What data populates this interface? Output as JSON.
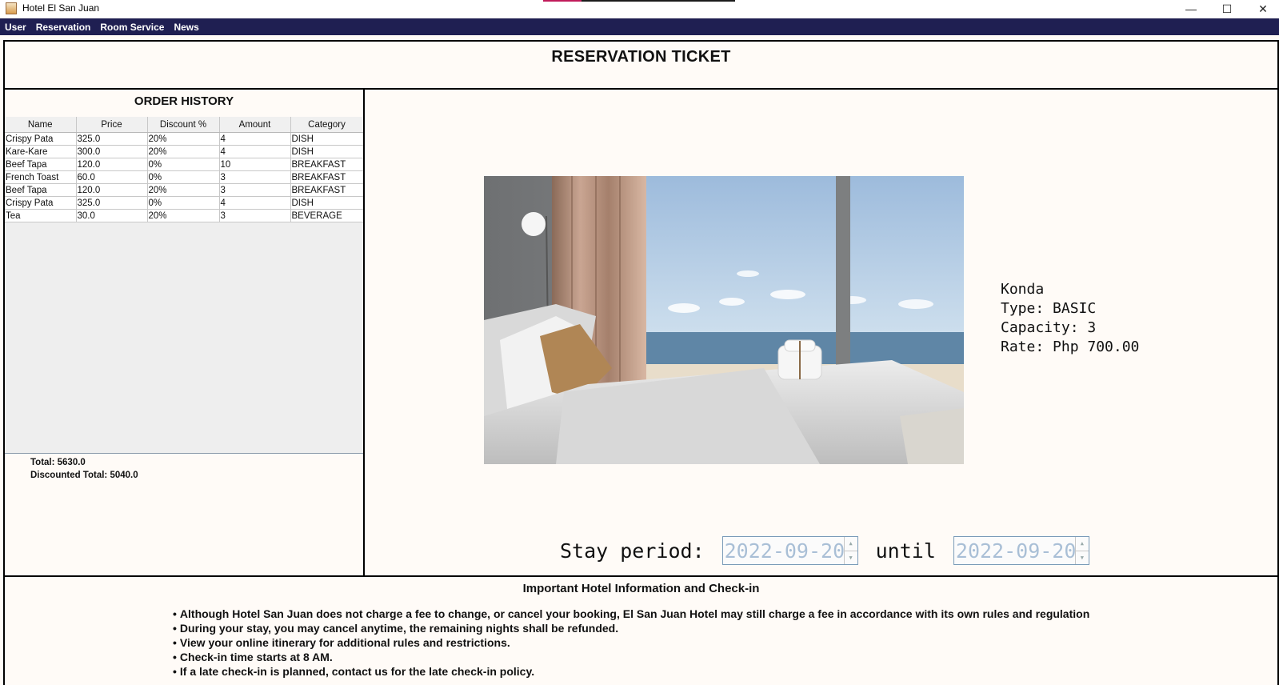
{
  "window": {
    "title": "Hotel El San Juan",
    "minimize_glyph": "—",
    "maximize_glyph": "☐",
    "close_glyph": "✕"
  },
  "menu": [
    "User",
    "Reservation",
    "Room Service",
    "News"
  ],
  "header": {
    "title": "RESERVATION TICKET"
  },
  "order_history": {
    "title": "ORDER HISTORY",
    "columns": [
      "Name",
      "Price",
      "Discount %",
      "Amount",
      "Category"
    ],
    "rows": [
      [
        "Crispy Pata",
        "325.0",
        "20%",
        "4",
        "DISH"
      ],
      [
        "Kare-Kare",
        "300.0",
        "20%",
        "4",
        "DISH"
      ],
      [
        "Beef Tapa",
        "120.0",
        "0%",
        "10",
        "BREAKFAST"
      ],
      [
        "French Toast",
        "60.0",
        "0%",
        "3",
        "BREAKFAST"
      ],
      [
        "Beef Tapa",
        "120.0",
        "20%",
        "3",
        "BREAKFAST"
      ],
      [
        "Crispy Pata",
        "325.0",
        "0%",
        "4",
        "DISH"
      ],
      [
        "Tea",
        "30.0",
        "20%",
        "3",
        "BEVERAGE"
      ]
    ],
    "total": "Total: 5630.0",
    "discounted_total": "Discounted Total: 5040.0"
  },
  "room": {
    "name": "Konda",
    "type": "Type: BASIC",
    "capacity": "Capacity: 3",
    "rate": "Rate: Php 700.00"
  },
  "stay": {
    "label": "Stay period:",
    "start": "2022-09-20",
    "until_label": "until",
    "end": "2022-09-20"
  },
  "info": {
    "title": "Important Hotel Information and Check-in",
    "items": [
      "Although Hotel San Juan does not charge a fee to change, or cancel your booking, El San Juan Hotel may still charge a fee in accordance with its own rules and regulation",
      "During your stay, you may cancel anytime, the remaining nights shall be refunded.",
      "View your online itinerary for additional rules and restrictions.",
      "Check-in time starts at 8 AM.",
      "If a late check-in is planned, contact us for the late check-in policy."
    ]
  },
  "colors": {
    "menubar": "#1f1f52",
    "background": "#fffbf7",
    "spinner_text": "#a9bfd6"
  }
}
